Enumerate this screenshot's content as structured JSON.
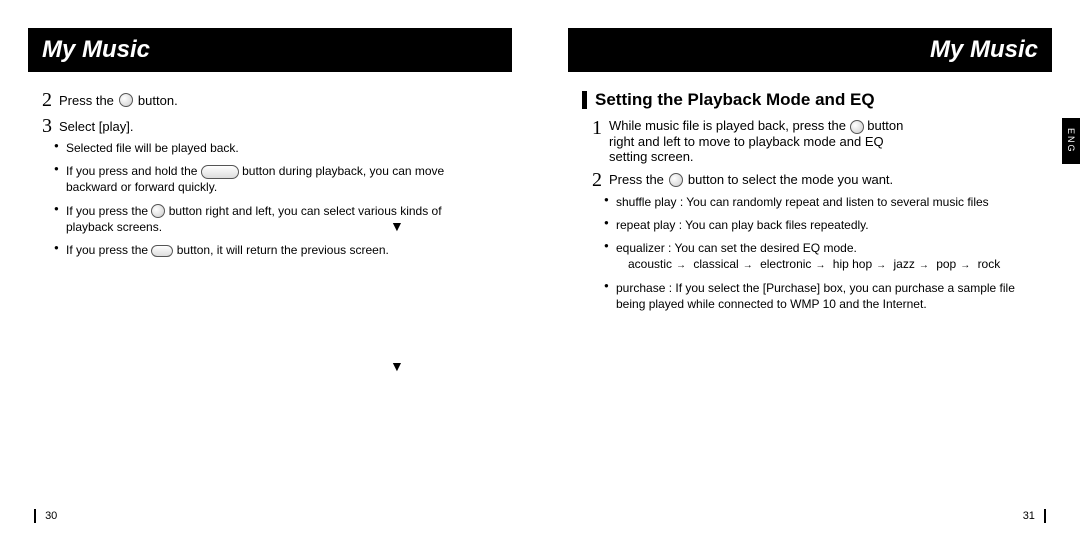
{
  "left": {
    "header": "My Music",
    "step2_pre": "Press the",
    "step2_post": "button.",
    "step3": "Select [play].",
    "b1": "Selected file will be played back.",
    "b2_pre": "If you press and hold the",
    "b2_post": "button during playback, you can move backward or forward quickly.",
    "b3_pre": "If you press the",
    "b3_post": "button right and left, you can select various kinds of playback screens.",
    "b4_pre": "If you press the",
    "b4_post": "button, it will return the previous screen.",
    "page_num": "30"
  },
  "down_arrow": "▼",
  "right": {
    "header": "My Music",
    "section": "Setting the Playback Mode and EQ",
    "step1_pre": "While music file is played back, press the",
    "step1_post": "button right and left to move to playback mode and EQ setting screen.",
    "step2_pre": "Press the",
    "step2_post": "button to select the mode you want.",
    "rb1": "shuffle play : You can randomly repeat and listen to several music files",
    "rb2": "repeat play : You can play back files repeatedly.",
    "rb3": "equalizer : You can set the desired EQ mode.",
    "eq_chain": [
      "acoustic",
      "classical",
      "electronic",
      "hip hop",
      "jazz",
      "pop",
      "rock"
    ],
    "rb4": "purchase : If you select the [Purchase] box, you can purchase a sample file being played while connected to WMP 10 and the Internet.",
    "eng_tab": "ENG",
    "page_num": "31"
  },
  "num2": "2",
  "num3": "3",
  "num1": "1"
}
